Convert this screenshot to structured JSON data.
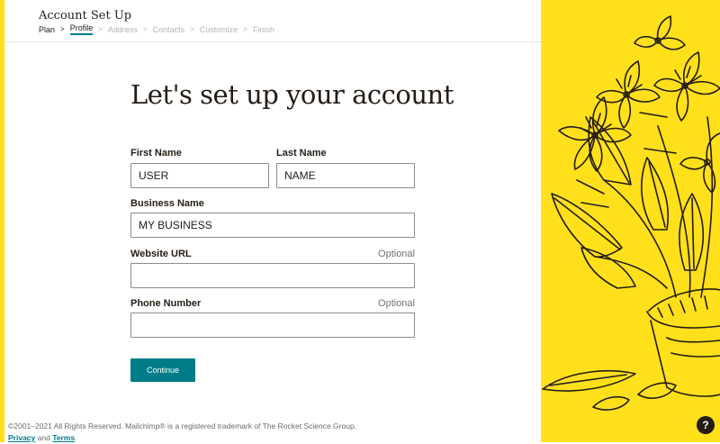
{
  "header": {
    "title": "Account Set Up",
    "steps": [
      {
        "label": "Plan",
        "state": "done"
      },
      {
        "label": "Profile",
        "state": "current"
      },
      {
        "label": "Address",
        "state": "upcoming"
      },
      {
        "label": "Contacts",
        "state": "upcoming"
      },
      {
        "label": "Customize",
        "state": "upcoming"
      },
      {
        "label": "Finish",
        "state": "upcoming"
      }
    ],
    "separator": ">"
  },
  "form": {
    "heading": "Let's set up your account",
    "first_name": {
      "label": "First Name",
      "value": "USER"
    },
    "last_name": {
      "label": "Last Name",
      "value": "NAME"
    },
    "business_name": {
      "label": "Business Name",
      "value": "MY BUSINESS"
    },
    "website_url": {
      "label": "Website URL",
      "value": "",
      "optional_label": "Optional"
    },
    "phone_number": {
      "label": "Phone Number",
      "value": "",
      "optional_label": "Optional"
    },
    "continue_label": "Continue"
  },
  "footer": {
    "copyright": "©2001–2021 All Rights Reserved. Mailchimp® is a registered trademark of The Rocket Science Group.",
    "privacy_label": "Privacy",
    "and_text": "and",
    "terms_label": "Terms",
    "period": "."
  },
  "help": {
    "label": "?"
  },
  "colors": {
    "brand_yellow": "#ffe01b",
    "accent_teal": "#007c89",
    "text_dark": "#241c15"
  },
  "icons": {
    "help": "question-mark-icon",
    "illustration": "plant-illustration"
  }
}
